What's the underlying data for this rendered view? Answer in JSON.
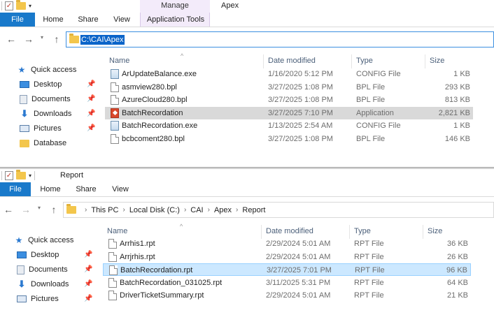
{
  "window1": {
    "title": "Apex",
    "contextual_tab": "Manage",
    "tabs": [
      "File",
      "Home",
      "Share",
      "View",
      "Application Tools"
    ],
    "address": "C:\\CAI\\Apex",
    "nav": [
      {
        "label": "Quick access",
        "icon": "star-icon",
        "pinned": false
      },
      {
        "label": "Desktop",
        "icon": "desktop-icon",
        "pinned": true
      },
      {
        "label": "Documents",
        "icon": "documents-icon",
        "pinned": true
      },
      {
        "label": "Downloads",
        "icon": "download-icon",
        "pinned": true
      },
      {
        "label": "Pictures",
        "icon": "pictures-icon",
        "pinned": true
      },
      {
        "label": "Database",
        "icon": "folder-icon",
        "pinned": false
      }
    ],
    "columns": [
      "Name",
      "Date modified",
      "Type",
      "Size"
    ],
    "files": [
      {
        "name": "ArUpdateBalance.exe",
        "date": "1/16/2020 5:12 PM",
        "type": "CONFIG File",
        "size": "1 KB",
        "icon": "config-file-icon"
      },
      {
        "name": "asmview280.bpl",
        "date": "3/27/2025 1:08 PM",
        "type": "BPL File",
        "size": "293 KB",
        "icon": "file-icon"
      },
      {
        "name": "AzureCloud280.bpl",
        "date": "3/27/2025 1:08 PM",
        "type": "BPL File",
        "size": "813 KB",
        "icon": "file-icon"
      },
      {
        "name": "BatchRecordation",
        "date": "3/27/2025 7:10 PM",
        "type": "Application",
        "size": "2,821 KB",
        "icon": "application-icon"
      },
      {
        "name": "BatchRecordation.exe",
        "date": "1/13/2025 2:54 AM",
        "type": "CONFIG File",
        "size": "1 KB",
        "icon": "config-file-icon"
      },
      {
        "name": "bcbcoment280.bpl",
        "date": "3/27/2025 1:08 PM",
        "type": "BPL File",
        "size": "146 KB",
        "icon": "file-icon"
      }
    ]
  },
  "window2": {
    "title": "Report",
    "tabs": [
      "File",
      "Home",
      "Share",
      "View"
    ],
    "breadcrumbs": [
      "This PC",
      "Local Disk (C:)",
      "CAI",
      "Apex",
      "Report"
    ],
    "nav": [
      {
        "label": "Quick access",
        "icon": "star-icon",
        "pinned": false
      },
      {
        "label": "Desktop",
        "icon": "desktop-icon",
        "pinned": true
      },
      {
        "label": "Documents",
        "icon": "documents-icon",
        "pinned": true
      },
      {
        "label": "Downloads",
        "icon": "download-icon",
        "pinned": true
      },
      {
        "label": "Pictures",
        "icon": "pictures-icon",
        "pinned": true
      }
    ],
    "columns": [
      "Name",
      "Date modified",
      "Type",
      "Size"
    ],
    "files": [
      {
        "name": "Arrhis1.rpt",
        "date": "2/29/2024 5:01 AM",
        "type": "RPT File",
        "size": "36 KB",
        "icon": "file-icon"
      },
      {
        "name": "Arrjrhis.rpt",
        "date": "2/29/2024 5:01 AM",
        "type": "RPT File",
        "size": "26 KB",
        "icon": "file-icon"
      },
      {
        "name": "BatchRecordation.rpt",
        "date": "3/27/2025 7:01 PM",
        "type": "RPT File",
        "size": "96 KB",
        "icon": "file-icon"
      },
      {
        "name": "BatchRecordation_031025.rpt",
        "date": "3/11/2025 5:31 PM",
        "type": "RPT File",
        "size": "64 KB",
        "icon": "file-icon"
      },
      {
        "name": "DriverTicketSummary.rpt",
        "date": "2/29/2024 5:01 AM",
        "type": "RPT File",
        "size": "21 KB",
        "icon": "file-icon"
      }
    ]
  }
}
